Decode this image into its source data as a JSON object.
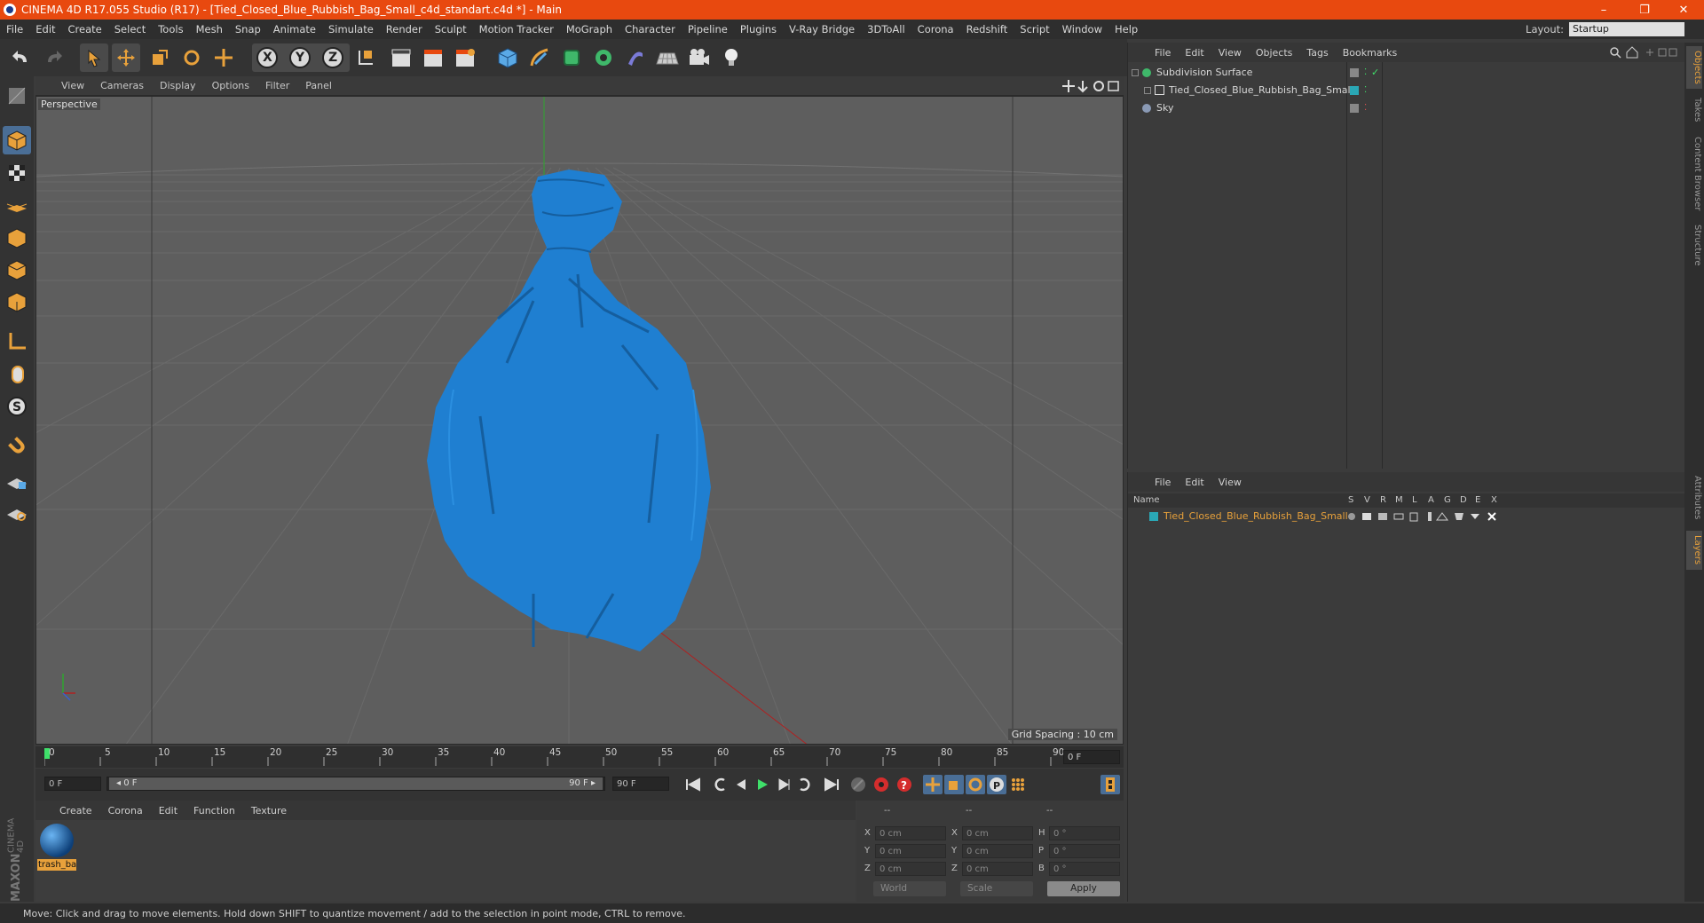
{
  "window": {
    "title": "CINEMA 4D R17.055 Studio (R17) - [Tied_Closed_Blue_Rubbish_Bag_Small_c4d_standart.c4d *] - Main",
    "minimize": "–",
    "restore": "❐",
    "close": "✕"
  },
  "menu": [
    "File",
    "Edit",
    "Create",
    "Select",
    "Tools",
    "Mesh",
    "Snap",
    "Animate",
    "Simulate",
    "Render",
    "Sculpt",
    "Motion Tracker",
    "MoGraph",
    "Character",
    "Pipeline",
    "Plugins",
    "V-Ray Bridge",
    "3DToAll",
    "Corona",
    "Redshift",
    "Script",
    "Window",
    "Help"
  ],
  "layout": {
    "label": "Layout:",
    "value": "Startup"
  },
  "toolbar": {
    "x_label": "X",
    "y_label": "Y",
    "z_label": "Z"
  },
  "viewport": {
    "menu": [
      "View",
      "Cameras",
      "Display",
      "Options",
      "Filter",
      "Panel"
    ],
    "camera_label": "Perspective",
    "grid_spacing": "Grid Spacing : 10 cm",
    "colors": {
      "bag": "#1f7fd1",
      "background": "#5e5e5e"
    }
  },
  "timeline": {
    "ticks": [
      "0",
      "5",
      "10",
      "15",
      "20",
      "25",
      "30",
      "35",
      "40",
      "45",
      "50",
      "55",
      "60",
      "65",
      "70",
      "75",
      "80",
      "85",
      "90"
    ],
    "current_frame": "0 F"
  },
  "transport": {
    "start_field": "0 F",
    "range_start": "◂ 0 F",
    "range_end": "90 F ▸",
    "end_field": "90 F"
  },
  "materials": {
    "menu": [
      "Create",
      "Corona",
      "Edit",
      "Function",
      "Texture"
    ],
    "items": [
      {
        "name": "trash_ba"
      }
    ]
  },
  "coordinates": {
    "headers": [
      "--",
      "--",
      "--"
    ],
    "rows": [
      {
        "a_label": "X",
        "a_val": "0 cm",
        "b_label": "X",
        "b_val": "0 cm",
        "c_label": "H",
        "c_val": "0 °"
      },
      {
        "a_label": "Y",
        "a_val": "0 cm",
        "b_label": "Y",
        "b_val": "0 cm",
        "c_label": "P",
        "c_val": "0 °"
      },
      {
        "a_label": "Z",
        "a_val": "0 cm",
        "b_label": "Z",
        "b_val": "0 cm",
        "c_label": "B",
        "c_val": "0 °"
      }
    ],
    "mode1": "World",
    "mode2": "Scale",
    "apply": "Apply"
  },
  "objects_panel": {
    "menu": [
      "File",
      "Edit",
      "View",
      "Objects",
      "Tags",
      "Bookmarks"
    ],
    "items": [
      {
        "name": "Subdivision Surface",
        "color": "#3fb86a"
      },
      {
        "name": "Tied_Closed_Blue_Rubbish_Bag_Small",
        "color": "#2aa7b5"
      },
      {
        "name": "Sky",
        "color": "#8a9ab5"
      }
    ]
  },
  "layers_panel": {
    "menu": [
      "File",
      "Edit",
      "View"
    ],
    "columns": [
      "Name",
      "S",
      "V",
      "R",
      "M",
      "L",
      "A",
      "G",
      "D",
      "E",
      "X"
    ],
    "rows": [
      {
        "name": "Tied_Closed_Blue_Rubbish_Bag_Small",
        "color": "#2aa7b5"
      }
    ]
  },
  "side_tabs": [
    "Objects",
    "Takes",
    "Content Browser",
    "Structure",
    "Attributes",
    "Layers"
  ],
  "branding": {
    "line1": "MAXON",
    "line2": "CINEMA 4D"
  },
  "status": "Move: Click and drag to move elements. Hold down SHIFT to quantize movement / add to the selection in point mode, CTRL to remove."
}
